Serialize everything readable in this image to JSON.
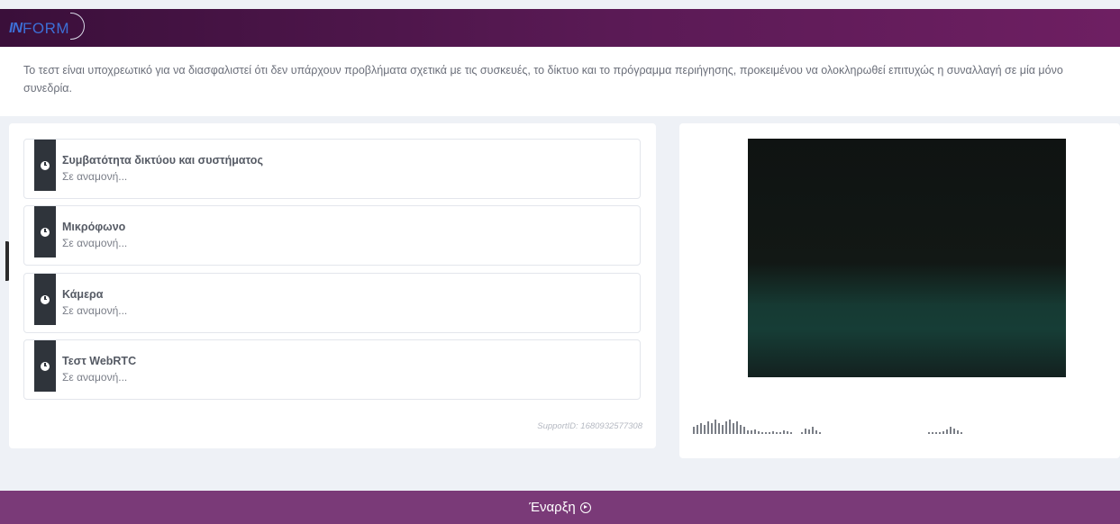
{
  "header": {
    "logo_mark": "IN",
    "logo_text": "FORM"
  },
  "intro": {
    "text": "Το τεστ είναι υποχρεωτικό για να διασφαλιστεί ότι δεν υπάρχουν προβλήματα σχετικά με τις συσκευές, το δίκτυο και το πρόγραμμα περιήγησης, προκειμένου να ολοκληρωθεί επιτυχώς η συναλλαγή σε μία μόνο συνεδρία."
  },
  "checks": [
    {
      "title": "Συμβατότητα δικτύου και συστήματος",
      "status": "Σε αναμονή...",
      "icon": "clock-icon"
    },
    {
      "title": "Μικρόφωνο",
      "status": "Σε αναμονή...",
      "icon": "clock-icon"
    },
    {
      "title": "Κάμερα",
      "status": "Σε αναμονή...",
      "icon": "clock-icon"
    },
    {
      "title": "Τεστ WebRTC",
      "status": "Σε αναμονή...",
      "icon": "clock-icon"
    }
  ],
  "support": {
    "text": "SupportID: 1680932577308"
  },
  "audio_levels": {
    "left": [
      8,
      10,
      12,
      10,
      14,
      12,
      16,
      12,
      10,
      14,
      16,
      12,
      14,
      10,
      8,
      4,
      4,
      5,
      3,
      2,
      2,
      2,
      3,
      2,
      2,
      4,
      3,
      2,
      0,
      0,
      2,
      6,
      5,
      8,
      4,
      2
    ],
    "right": [
      2,
      2,
      2,
      2,
      3,
      5,
      8,
      6,
      4,
      2
    ]
  },
  "footer": {
    "start_label": "Έναρξη",
    "start_icon": "play-circle-icon"
  },
  "colors": {
    "header_gradient_start": "#3a0f3a",
    "header_gradient_end": "#6e1f62",
    "footer": "#7a3a78",
    "logo": "#3d6fd6",
    "status_strip": "#2f343b"
  }
}
